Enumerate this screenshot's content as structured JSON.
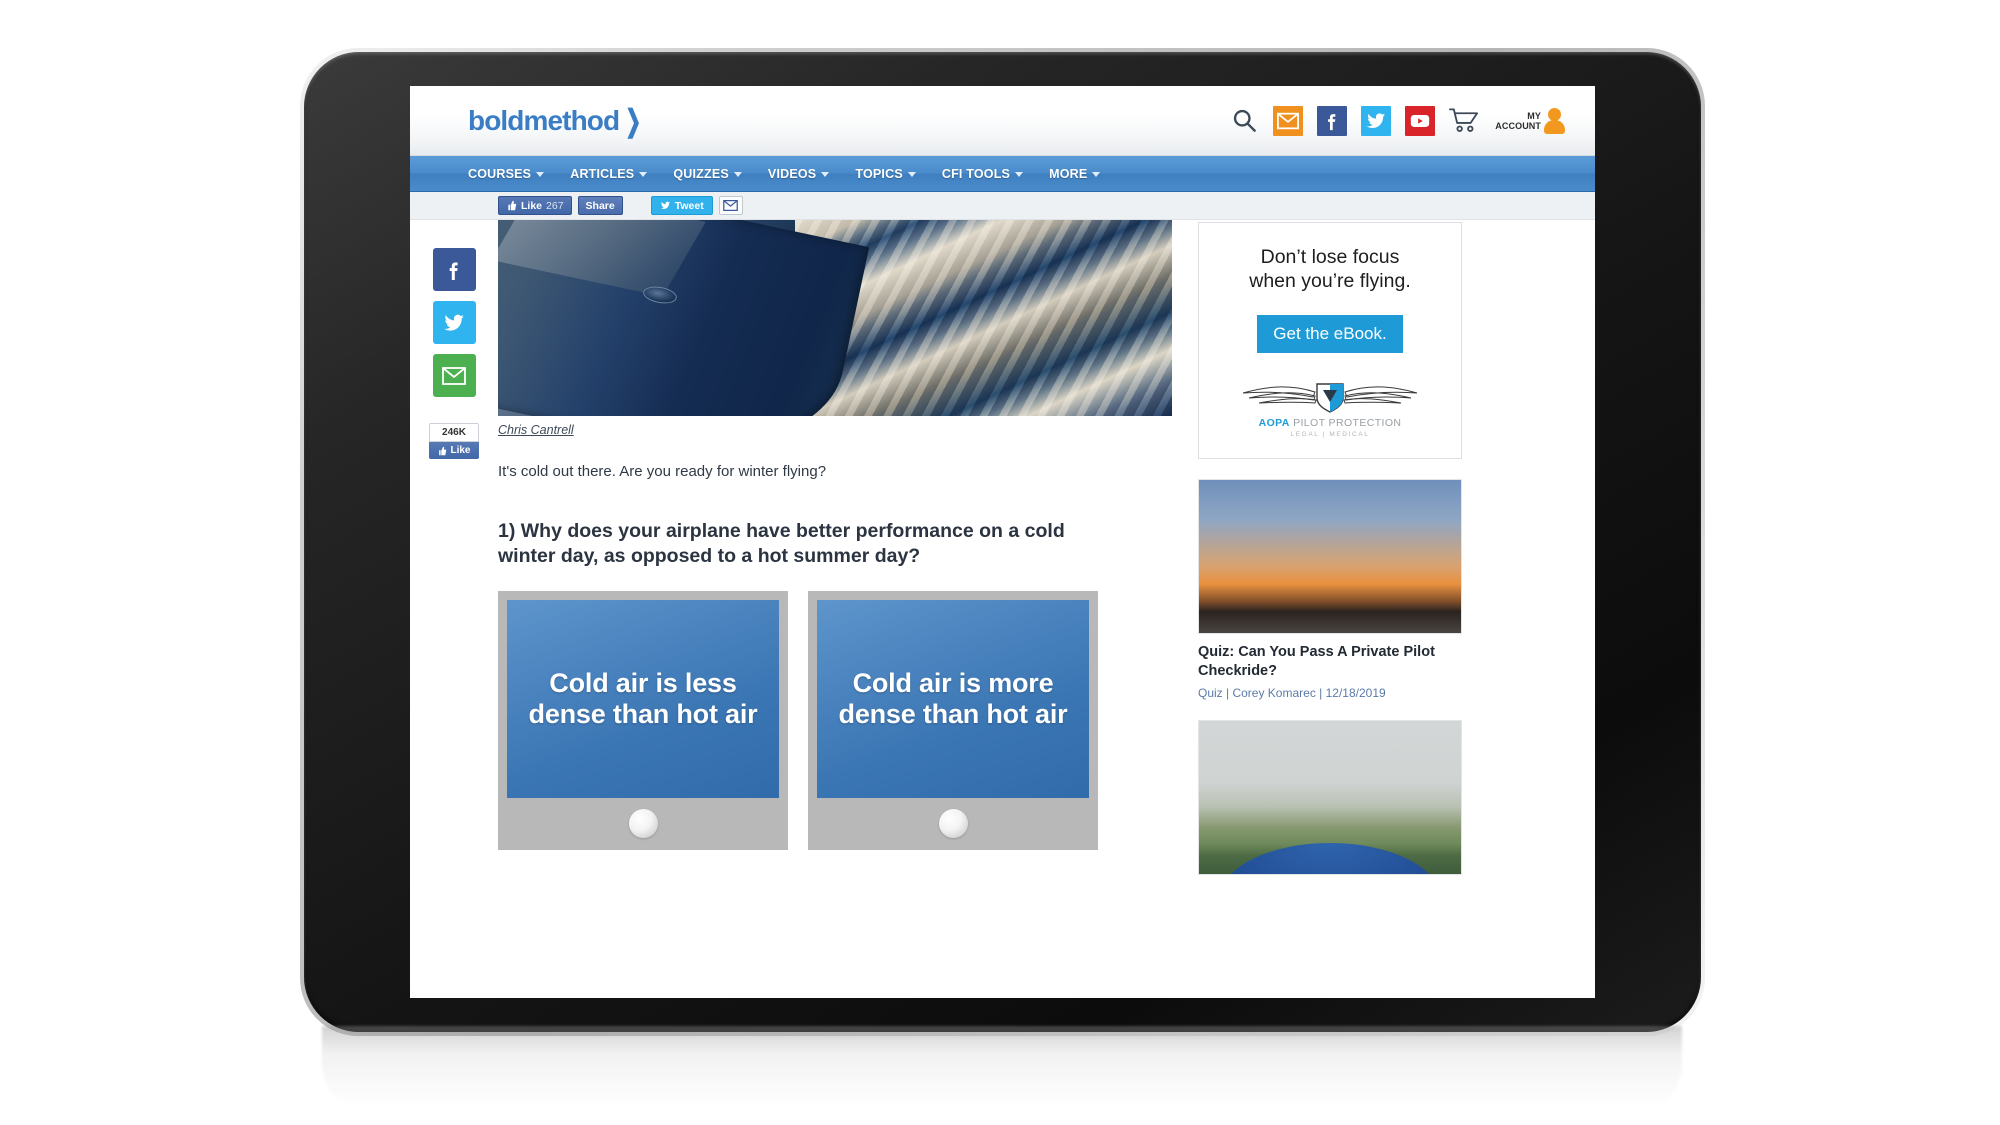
{
  "header": {
    "logo_text": "boldmethod",
    "logo_chevron": "❯",
    "icons": [
      {
        "name": "search-icon",
        "label": "Search"
      },
      {
        "name": "email-icon",
        "label": "Email"
      },
      {
        "name": "facebook-icon",
        "label": "Facebook"
      },
      {
        "name": "twitter-icon",
        "label": "Twitter"
      },
      {
        "name": "youtube-icon",
        "label": "YouTube"
      },
      {
        "name": "cart-icon",
        "label": "Cart"
      }
    ],
    "my_account_line1": "MY",
    "my_account_line2": "ACCOUNT"
  },
  "nav": {
    "items": [
      {
        "label": "COURSES",
        "has_caret": true
      },
      {
        "label": "ARTICLES",
        "has_caret": true
      },
      {
        "label": "QUIZZES",
        "has_caret": true
      },
      {
        "label": "VIDEOS",
        "has_caret": true
      },
      {
        "label": "TOPICS",
        "has_caret": true
      },
      {
        "label": "CFI TOOLS",
        "has_caret": true
      },
      {
        "label": "MORE",
        "has_caret": true
      }
    ]
  },
  "share_strip": {
    "like_label": "Like",
    "like_count": "267",
    "share_label": "Share",
    "tweet_label": "Tweet",
    "email_icon": "envelope-icon"
  },
  "share_rail": {
    "facebook_icon": "facebook-icon",
    "twitter_icon": "twitter-icon",
    "email_icon": "envelope-icon",
    "like_count": "246K",
    "like_label": "Like"
  },
  "article": {
    "hero_alt": "Airplane wing over snow covered mountains",
    "photo_credit": "Chris Cantrell",
    "lede": "It's cold out there. Are you ready for winter flying?",
    "question": "1) Why does your airplane have better performance on a cold winter day, as opposed to a hot summer day?",
    "answers": [
      {
        "text": "Cold air is less dense than hot air"
      },
      {
        "text": "Cold air is more dense than hot air"
      }
    ]
  },
  "sidebar": {
    "ad": {
      "headline_line1": "Don’t lose focus",
      "headline_line2": "when you’re flying.",
      "cta_label": "Get the eBook.",
      "brand_bold": "AOPA",
      "brand_rest": " PILOT PROTECTION",
      "brand_sub": "LEGAL  |  MEDICAL"
    },
    "cards": [
      {
        "thumb": "sunset-airplane-photo",
        "title": "Quiz: Can You Pass A Private Pilot Checkride?",
        "meta": "Quiz | Corey Komarec | 12/18/2019"
      },
      {
        "thumb": "foggy-aerial-photo",
        "title": "",
        "meta": ""
      }
    ]
  },
  "colors": {
    "brand_blue": "#3b7dc4",
    "nav_blue": "#4a8ccb",
    "facebook": "#3b5998",
    "twitter": "#2fb4ef",
    "youtube": "#d9242a",
    "email_orange": "#f0901e",
    "email_green": "#4caf50",
    "cta_blue": "#1e9bd7",
    "card_gray": "#b8b8b8"
  }
}
